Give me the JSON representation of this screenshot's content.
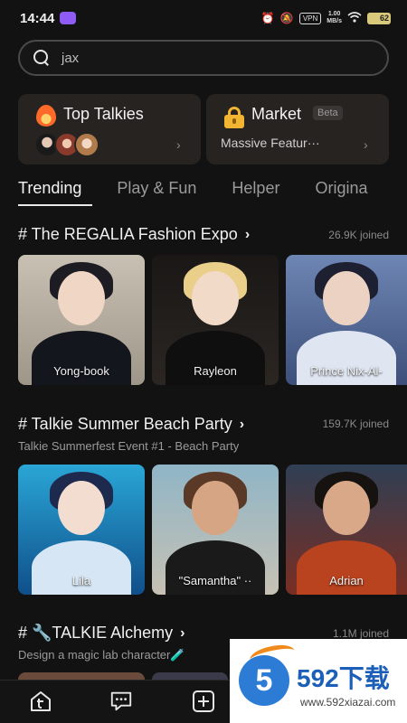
{
  "status_bar": {
    "time": "14:44",
    "vpn": "VPN",
    "speed_value": "1.00",
    "speed_unit": "MB/s",
    "battery": "62"
  },
  "search": {
    "value": "jax"
  },
  "top_cards": {
    "left": {
      "title": "Top Talkies"
    },
    "right": {
      "title": "Market",
      "badge": "Beta",
      "subtitle": "Massive Featur···"
    }
  },
  "tabs": [
    "Trending",
    "Play & Fun",
    "Helper",
    "Origina"
  ],
  "sections": [
    {
      "title": "# The REGALIA Fashion Expo",
      "count": "26.9K joined",
      "items": [
        "Yong-book",
        "Rayleon",
        "Prince Nix-Al-"
      ]
    },
    {
      "title": "# Talkie Summer Beach Party",
      "count": "159.7K joined",
      "subtitle": "Talkie Summerfest Event #1 - Beach Party",
      "items": [
        "Lila",
        "\"Samantha\" ··",
        "Adrian"
      ]
    },
    {
      "title": "# 🔧TALKIE Alchemy",
      "count": "1.1M joined",
      "subtitle": "Design a magic lab character🧪"
    }
  ],
  "watermark": {
    "logo_digit": "5",
    "brand": "592下载",
    "url": "www.592xiazai.com"
  },
  "colors": {
    "background": "#121212",
    "card": "#272320",
    "accent_purple": "#8e5cf5",
    "watermark_blue": "#1b5fb8"
  }
}
